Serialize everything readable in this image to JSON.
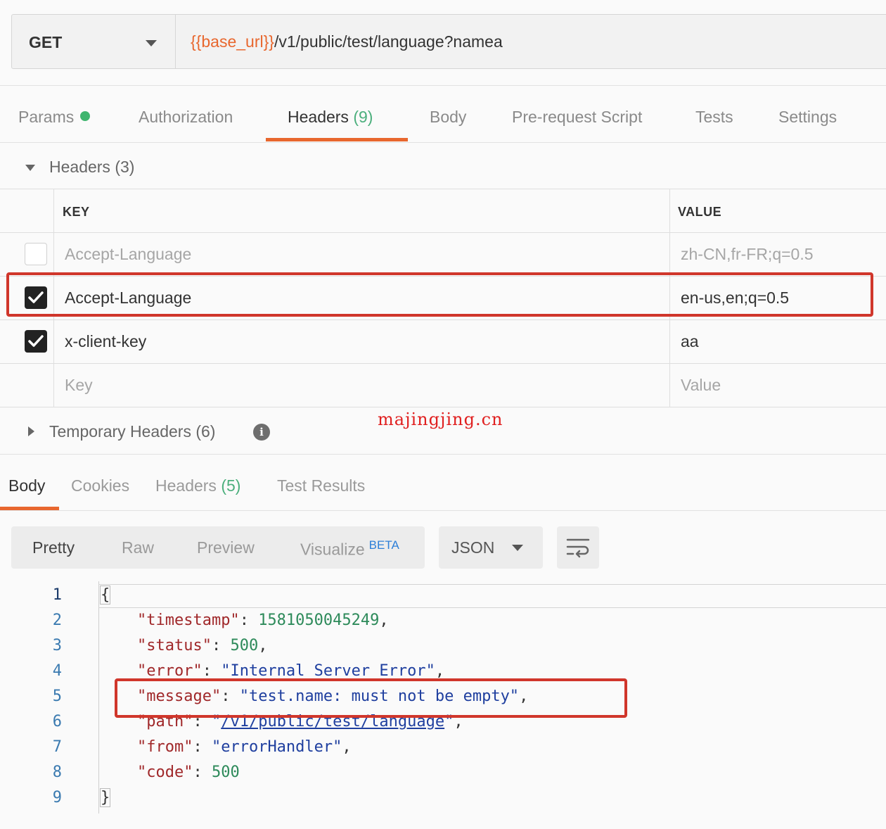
{
  "request": {
    "method": "GET",
    "url_var": "{{base_url}}",
    "url_path": "/v1/public/test/language?namea"
  },
  "request_tabs": [
    {
      "label": "Params",
      "dot": true
    },
    {
      "label": "Authorization"
    },
    {
      "label": "Headers",
      "count": "(9)",
      "active": true
    },
    {
      "label": "Body"
    },
    {
      "label": "Pre-request Script"
    },
    {
      "label": "Tests"
    },
    {
      "label": "Settings"
    }
  ],
  "headers_section": {
    "title": "Headers",
    "count": "(3)",
    "col_key": "KEY",
    "col_value": "VALUE",
    "rows": [
      {
        "checked": false,
        "key": "Accept-Language",
        "value": "zh-CN,fr-FR;q=0.5"
      },
      {
        "checked": true,
        "key": "Accept-Language",
        "value": "en-us,en;q=0.5"
      },
      {
        "checked": true,
        "key": "x-client-key",
        "value": "aa"
      }
    ],
    "key_placeholder": "Key",
    "value_placeholder": "Value"
  },
  "temporary_headers": {
    "title": "Temporary Headers",
    "count": "(6)",
    "info_glyph": "i"
  },
  "watermark": "majingjing.cn",
  "response_tabs": [
    {
      "label": "Body",
      "active": true
    },
    {
      "label": "Cookies"
    },
    {
      "label": "Headers",
      "count": "(5)"
    },
    {
      "label": "Test Results"
    }
  ],
  "view_modes": [
    "Pretty",
    "Raw",
    "Preview",
    "Visualize"
  ],
  "beta_label": "BETA",
  "format": "JSON",
  "code_lines": [
    {
      "no": "1",
      "open": "{"
    },
    {
      "no": "2",
      "key": "\"timestamp\"",
      "sep": ": ",
      "num": "1581050045249",
      "end": ","
    },
    {
      "no": "3",
      "key": "\"status\"",
      "sep": ": ",
      "num": "500",
      "end": ","
    },
    {
      "no": "4",
      "key": "\"error\"",
      "sep": ": ",
      "str": "\"Internal Server Error\"",
      "end": ","
    },
    {
      "no": "5",
      "key": "\"message\"",
      "sep": ": ",
      "str": "\"test.name: must not be empty\"",
      "end": ","
    },
    {
      "no": "6",
      "key": "\"path\"",
      "sep": ": ",
      "q1": "\"",
      "link": "/v1/public/test/language",
      "q2": "\"",
      "end": ","
    },
    {
      "no": "7",
      "key": "\"from\"",
      "sep": ": ",
      "str": "\"errorHandler\"",
      "end": ","
    },
    {
      "no": "8",
      "key": "\"code\"",
      "sep": ": ",
      "num": "500",
      "end": ""
    },
    {
      "no": "9",
      "open": "}"
    }
  ],
  "colors": {
    "accent": "#e8672e",
    "highlight_box": "#d0362b",
    "count_green": "#4caf7d"
  }
}
